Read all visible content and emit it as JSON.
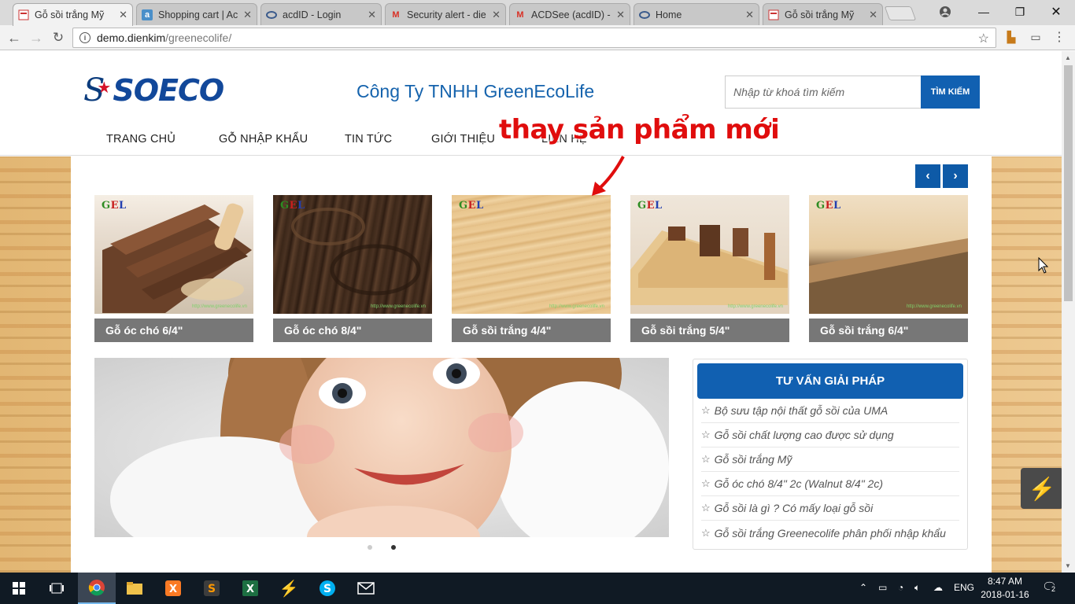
{
  "tabs": [
    {
      "title": "Gỗ sồi trắng Mỹ",
      "favicon": "site-favicon"
    },
    {
      "title": "Shopping cart | Ac",
      "favicon": "a-favicon"
    },
    {
      "title": "acdID - Login",
      "favicon": "acd-favicon"
    },
    {
      "title": "Security alert - die",
      "favicon": "gmail-favicon"
    },
    {
      "title": "ACDSee (acdID) - I",
      "favicon": "gmail-favicon"
    },
    {
      "title": "Home",
      "favicon": "acd-favicon"
    },
    {
      "title": "Gỗ sồi trắng Mỹ",
      "favicon": "site-favicon"
    }
  ],
  "address": {
    "host": "demo.dienkim",
    "path": "/greenecolife/"
  },
  "site": {
    "logo": "SOECO",
    "company": "Công Ty TNHH GreenEcoLife",
    "search_placeholder": "Nhập từ khoá tìm kiếm",
    "search_button": "TÌM KIẾM",
    "nav": [
      "TRANG CHỦ",
      "GỖ NHẬP KHẨU",
      "TIN TỨC",
      "GIỚI THIỆU",
      "LIÊN HỆ"
    ]
  },
  "annotation": "thay sản phẩm mới",
  "products": [
    {
      "name": "Gỗ óc chó 6/4\"",
      "gel": "GEL",
      "watermark": "http://www.greenecolife.vn"
    },
    {
      "name": "Gỗ óc chó 8/4\"",
      "gel": "GEL",
      "watermark": "http://www.greenecolife.vn"
    },
    {
      "name": "Gỗ sồi trắng 4/4\"",
      "gel": "GEL",
      "watermark": "http://www.greenecolife.vn"
    },
    {
      "name": "Gỗ sồi trắng 5/4\"",
      "gel": "GEL",
      "watermark": "http://www.greenecolife.vn"
    },
    {
      "name": "Gỗ sồi trắng 6/4\"",
      "gel": "GEL",
      "watermark": "http://www.greenecolife.vn"
    }
  ],
  "slider": {
    "active_dot": 2,
    "dots": 2
  },
  "sidebar": {
    "title": "TƯ VẤN GIẢI PHÁP",
    "items": [
      "Bộ sưu tập nội thất gỗ sồi của UMA",
      "Gỗ sồi chất lượng cao được sử dụng",
      "Gỗ sồi trắng Mỹ",
      "Gỗ óc chó 8/4\" 2c (Walnut 8/4\" 2c)",
      "Gỗ sồi là gì ? Có mấy loại gỗ sồi",
      "Gỗ sồi trắng Greenecolife phân phối nhập khẩu"
    ]
  },
  "taskbar": {
    "lang": "ENG",
    "time": "8:47 AM",
    "date": "2018-01-16",
    "notifications": "2"
  }
}
